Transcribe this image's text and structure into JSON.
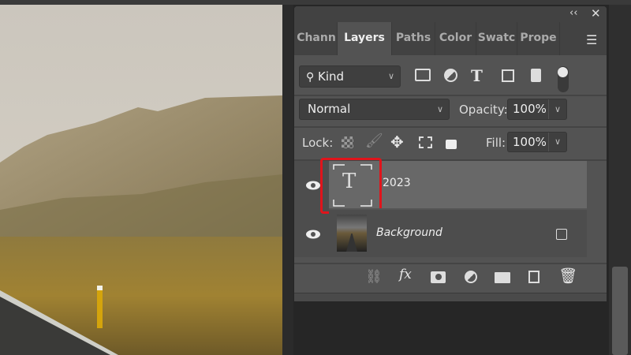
{
  "panel": {
    "collapse_icon": "double-chevron-left-icon",
    "close_icon": "close-icon",
    "tabs": [
      {
        "label": "Chann"
      },
      {
        "label": "Layers",
        "active": true
      },
      {
        "label": "Paths"
      },
      {
        "label": "Color"
      },
      {
        "label": "Swatc"
      },
      {
        "label": "Prope"
      }
    ],
    "filter": {
      "kind_label": "Kind"
    },
    "blend_mode": "Normal",
    "opacity_label": "Opacity:",
    "opacity_value": "100%",
    "lock_label": "Lock:",
    "fill_label": "Fill:",
    "fill_value": "100%",
    "layers": [
      {
        "name": "2023",
        "type": "text",
        "thumb_glyph": "T",
        "selected": true,
        "highlighted": true
      },
      {
        "name": "Background",
        "type": "image",
        "locked": true
      }
    ]
  },
  "colors": {
    "highlight": "#e0141b",
    "panel": "#535353",
    "tabbar": "#424242"
  }
}
